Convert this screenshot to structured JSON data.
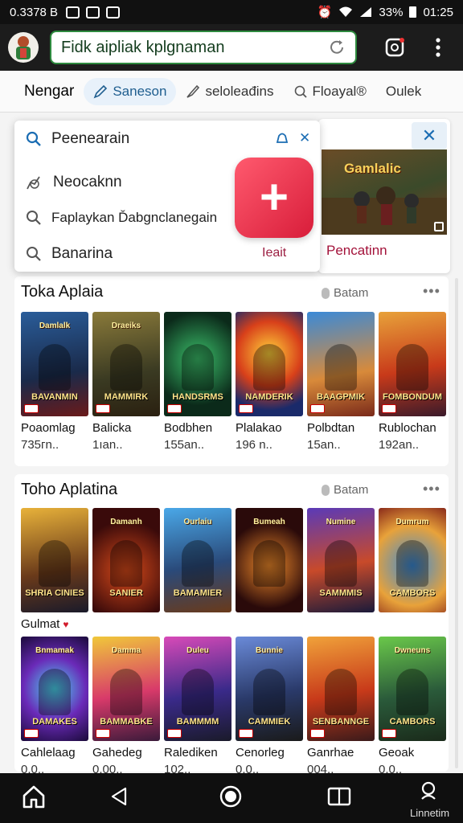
{
  "status_bar": {
    "left_text": "0.3378 B",
    "battery_text": "33%",
    "time": "01:25"
  },
  "toolbar": {
    "url_text": "Fidk aipliak kplgnaman"
  },
  "tabs": [
    {
      "label": "Nengar"
    },
    {
      "label": "Saneson"
    },
    {
      "label": "seloleađins"
    },
    {
      "label": "Floayal®"
    },
    {
      "label": "Oulek"
    }
  ],
  "dropdown": {
    "search_text": "Peenearain",
    "items": [
      "Neocaknn",
      "Faplaykan Ďabgnclanegain",
      "Banarina"
    ]
  },
  "badge": {
    "label": "Ieait"
  },
  "promo": {
    "label": "Pencatinn",
    "banner_text": "Gamlalic"
  },
  "sections": [
    {
      "title": "Toka Aplaia",
      "right_label": "Batam",
      "items": [
        {
          "name": "Poaomlag",
          "size": "735гn..",
          "poster_top": "Damlalk",
          "poster_text": "BAVANMIN"
        },
        {
          "name": "Balicka",
          "size": "1ıаn..",
          "poster_top": "Draeiks",
          "poster_text": "MAMMIRK"
        },
        {
          "name": "Bodbhen",
          "size": "155аn..",
          "poster_top": "",
          "poster_text": "HANDSRMS"
        },
        {
          "name": "Plalakao",
          "size": "196 n..",
          "poster_top": "",
          "poster_text": "NAMDERIK"
        },
        {
          "name": "Polbdtan",
          "size": "15аn..",
          "poster_top": "",
          "poster_text": "BAAGPMIK"
        },
        {
          "name": "Rublochan",
          "size": "192аn..",
          "poster_top": "",
          "poster_text": "FOMBONDUM"
        }
      ]
    },
    {
      "title": "Toho Aplatina",
      "right_label": "Batam",
      "items": [
        {
          "poster_top": "",
          "poster_text": "SHRIA CINIES"
        },
        {
          "poster_top": "Damanh",
          "poster_text": "SANIER"
        },
        {
          "poster_top": "Ourlaiu",
          "poster_text": "BAMAMIER"
        },
        {
          "poster_top": "Bumeah",
          "poster_text": ""
        },
        {
          "poster_top": "Numine",
          "poster_text": "SAMMMIS"
        },
        {
          "poster_top": "Dumrum",
          "poster_text": "CAMBORS"
        }
      ],
      "subhead": "Gulmat",
      "row2": [
        {
          "name": "Cahlelaag",
          "size": "0.0..",
          "poster_top": "Bnmamak",
          "poster_text": "DAMAKES"
        },
        {
          "name": "Gahedeg",
          "size": "0.00..",
          "poster_top": "Damma",
          "poster_text": "BAMMABKE"
        },
        {
          "name": "Ralediken",
          "size": "102..",
          "poster_top": "Duleu",
          "poster_text": "BAMMMM"
        },
        {
          "name": "Cenorleg",
          "size": "0.0..",
          "poster_top": "Bunnie",
          "poster_text": "CAMMIEK"
        },
        {
          "name": "Ganrhae",
          "size": "004..",
          "poster_top": "",
          "poster_text": "SENBANNGE"
        },
        {
          "name": "Geoak",
          "size": "0.0..",
          "poster_top": "Dwneuns",
          "poster_text": "CAMBORS"
        }
      ]
    }
  ],
  "nav": {
    "label": "Linnetim"
  },
  "colors": {
    "accent_green": "#2d8a3e",
    "accent_red": "#d81d3a",
    "accent_blue": "#1f5e8f"
  }
}
